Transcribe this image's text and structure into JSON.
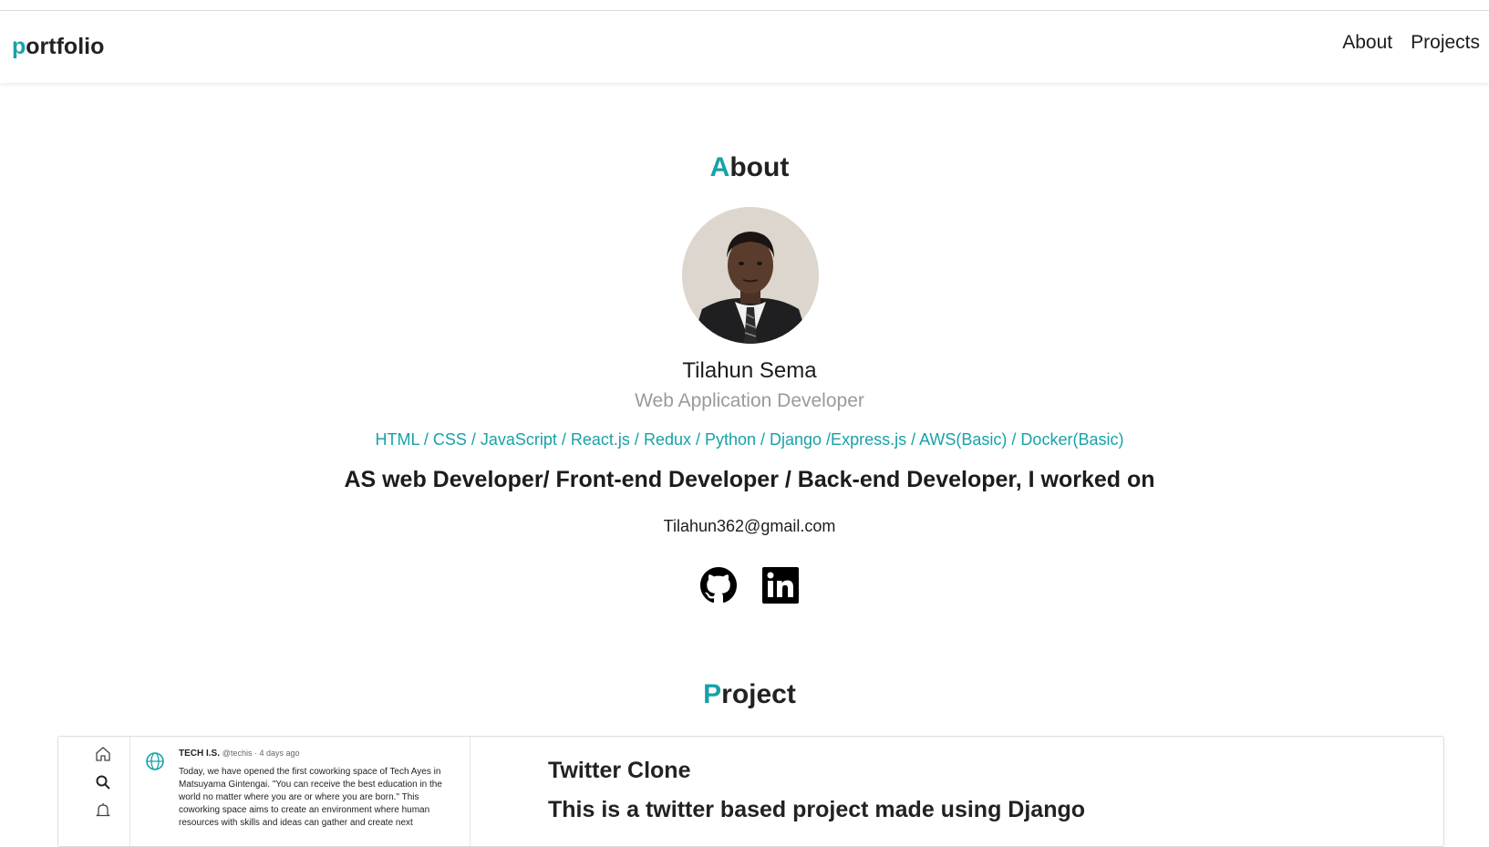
{
  "navbar": {
    "brand_accent": "p",
    "brand_rest": "ortfolio",
    "links": [
      "About",
      "Projects"
    ]
  },
  "about": {
    "title_accent": "A",
    "title_rest": "bout",
    "name": "Tilahun Sema",
    "role": "Web Application Developer",
    "skills": "HTML / CSS / JavaScript / React.js / Redux / Python / Django /Express.js / AWS(Basic) / Docker(Basic)",
    "statement": "AS web Developer/ Front-end Developer / Back-end Developer, I worked on",
    "email": "Tilahun362@gmail.com",
    "socials": [
      "github-icon",
      "linkedin-icon"
    ]
  },
  "project": {
    "title_accent": "P",
    "title_rest": "roject",
    "cards": [
      {
        "title": "Twitter Clone",
        "description": "This is a twitter based project made using Django",
        "screenshot": {
          "tweet_author": "TECH I.S.",
          "tweet_meta": "@techis · 4 days ago",
          "tweet_text": "Today, we have opened the first coworking space of Tech Ayes in Matsuyama Gintengai. \"You can receive the best education in the world no matter where you are or where you are born.\" This coworking space aims to create an environment where human resources with skills and ideas can gather and create next"
        }
      }
    ]
  },
  "colors": {
    "accent": "#17a2a8",
    "muted": "#9a9a9a"
  }
}
